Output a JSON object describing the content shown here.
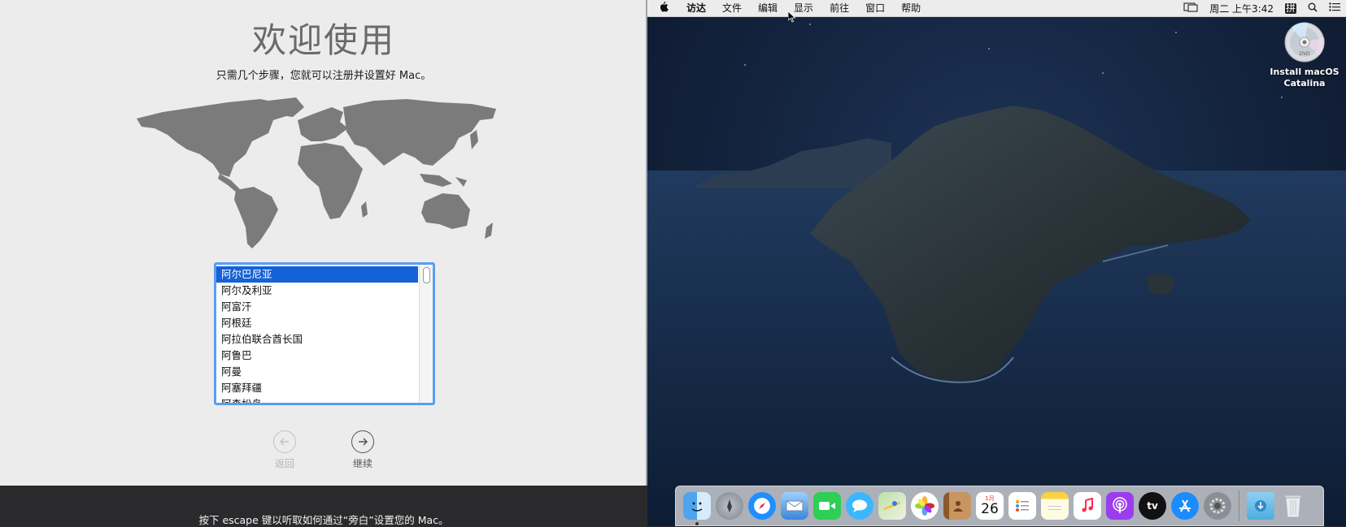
{
  "setup": {
    "title": "欢迎使用",
    "subtitle": "只需几个步骤，您就可以注册并设置好 Mac。",
    "countries": [
      "阿尔巴尼亚",
      "阿尔及利亚",
      "阿富汗",
      "阿根廷",
      "阿拉伯联合酋长国",
      "阿鲁巴",
      "阿曼",
      "阿塞拜疆",
      "阿森松岛"
    ],
    "selected_index": 0,
    "back_label": "返回",
    "continue_label": "继续",
    "voiceover_hint": "按下 escape 键以听取如何通过“旁白”设置您的 Mac。"
  },
  "menubar": {
    "apple_icon": "",
    "items": [
      "访达",
      "文件",
      "编辑",
      "显示",
      "前往",
      "窗口",
      "帮助"
    ],
    "clock": "周二 上午3:42",
    "ime": "拼",
    "icons": [
      "display-mirroring-icon",
      "input-method-icon",
      "spotlight-icon",
      "notification-center-icon"
    ]
  },
  "desktop": {
    "drive_label_line1": "Install macOS",
    "drive_label_line2": "Catalina"
  },
  "dock": {
    "calendar_month": "1月",
    "calendar_day": "26",
    "apps": [
      "Finder",
      "Launchpad",
      "Safari",
      "Mail",
      "FaceTime",
      "Messages",
      "Maps",
      "Photos",
      "Contacts",
      "Calendar",
      "Reminders",
      "Notes",
      "Music",
      "Podcasts",
      "TV",
      "App Store",
      "System Preferences",
      "Downloads",
      "Trash"
    ],
    "tv_label": "tv"
  },
  "colors": {
    "selection": "#1462d6",
    "list_focus_ring": "#5b9cf2",
    "setup_background": "#ececec",
    "desktop_night": "#14243f"
  }
}
